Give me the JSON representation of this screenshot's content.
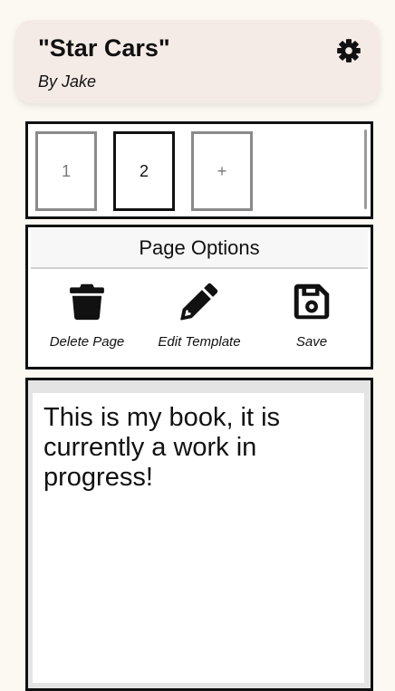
{
  "header": {
    "title": "\"Star Cars\"",
    "author": "By Jake",
    "settings_icon": "gear-icon"
  },
  "pages": {
    "items": [
      {
        "label": "1",
        "active": false
      },
      {
        "label": "2",
        "active": true
      },
      {
        "label": "+",
        "active": false
      }
    ]
  },
  "page_options": {
    "header": "Page Options",
    "delete_label": "Delete Page",
    "delete_icon": "trash-icon",
    "edit_label": "Edit Template",
    "edit_icon": "pencil-icon",
    "save_label": "Save",
    "save_icon": "floppy-disk-icon"
  },
  "editor": {
    "text": "This is my book, it is currently a work in progress!"
  }
}
